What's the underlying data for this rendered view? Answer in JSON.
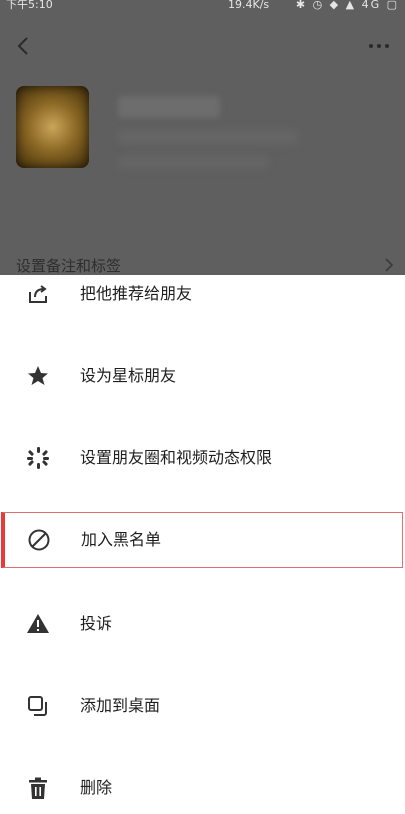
{
  "status_bar": {
    "time": "下午5:10",
    "net_speed": "19.4K/s",
    "icons": "✱ ◷ ◆ ▲ 4G ▢"
  },
  "header": {
    "back_icon": "chevron-left-icon",
    "more_icon": "more-icon"
  },
  "profile": {
    "remark_label": "设置备注和标签"
  },
  "menu": {
    "items": [
      {
        "label": "把他推荐给朋友",
        "icon": "share-icon"
      },
      {
        "label": "设为星标朋友",
        "icon": "star-icon"
      },
      {
        "label": "设置朋友圈和视频动态权限",
        "icon": "moments-icon"
      },
      {
        "label": "加入黑名单",
        "icon": "block-icon"
      },
      {
        "label": "投诉",
        "icon": "warning-icon"
      },
      {
        "label": "添加到桌面",
        "icon": "add-to-desktop-icon"
      },
      {
        "label": "删除",
        "icon": "trash-icon"
      }
    ],
    "highlight_color": "#e83a3a"
  }
}
